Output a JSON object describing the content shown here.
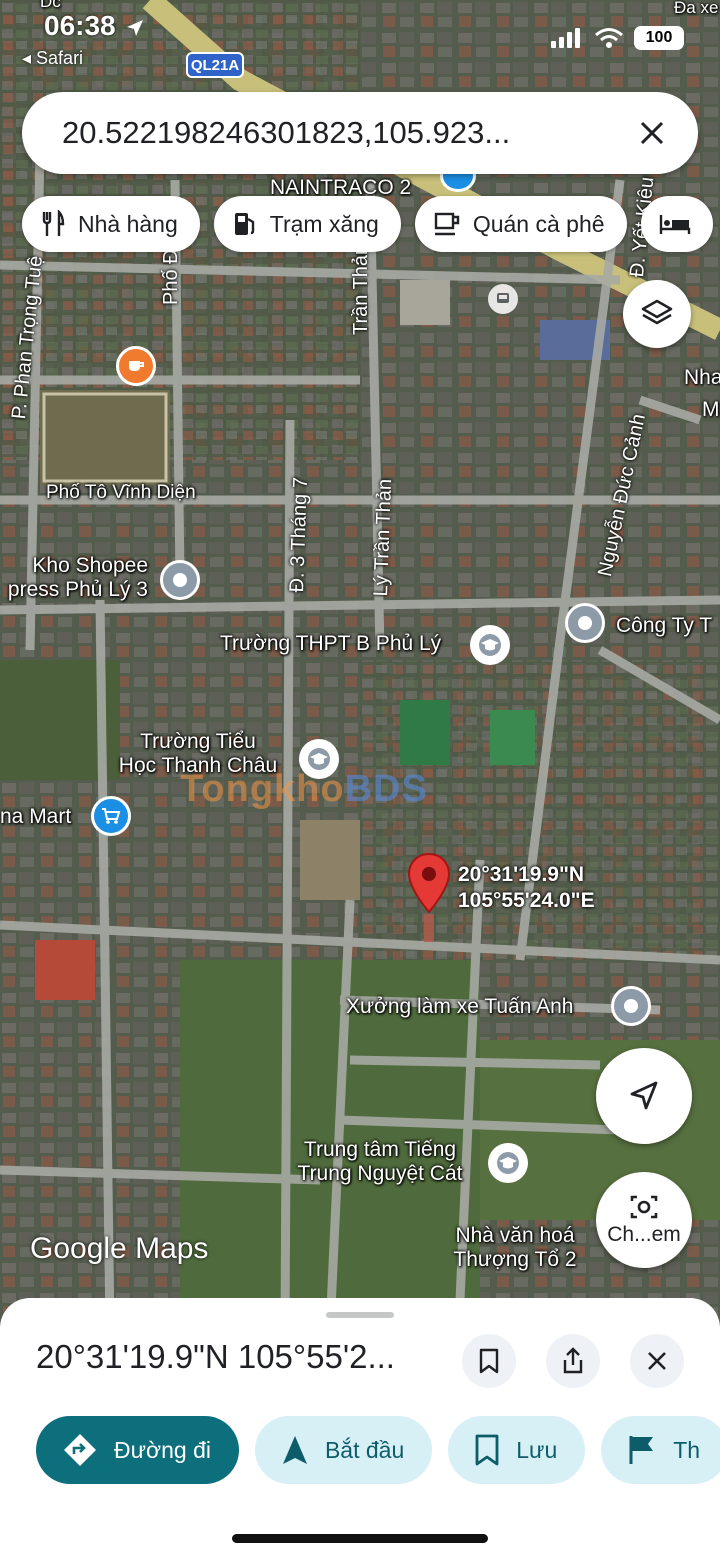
{
  "status": {
    "time": "06:38",
    "back_app": "◂ Safari",
    "battery": "100",
    "route_shield": "QL21A"
  },
  "search": {
    "query": "20.522198246301823,105.923...",
    "clear_icon": "close-icon"
  },
  "chips": [
    {
      "icon": "restaurant-icon",
      "label": "Nhà hàng"
    },
    {
      "icon": "gas-station-icon",
      "label": "Trạm xăng"
    },
    {
      "icon": "coffee-icon",
      "label": "Quán cà phê"
    },
    {
      "icon": "hotel-icon",
      "label": ""
    }
  ],
  "map": {
    "labels": {
      "naintraco": "NAINTRACO 2",
      "pho_to_vinh_dien": "Phố Tô Vĩnh Diện",
      "kho_shopee_1": "Kho Shopee",
      "kho_shopee_2": "press Phủ Lý 3",
      "cong_ty": "Công Ty T",
      "truong_thpt": "Trường THPT B Phủ Lý",
      "truong_tieu_hoc_1": "Trường Tiểu",
      "truong_tieu_hoc_2": "Học Thanh Châu",
      "mart": "na Mart",
      "xuong": "Xưởng làm xe Tuấn Anh",
      "trung_tam_1": "Trung tâm Tiếng",
      "trung_tam_2": "Trung Nguyệt Cát",
      "nha_van_hoa_1": "Nhà văn hoá",
      "nha_van_hoa_2": "Thượng Tổ 2",
      "nha_edge": "Nha",
      "m_edge": "M",
      "da_xe": "Đa xe",
      "top_dc": "Dc"
    },
    "street_labels": {
      "phan_trong_tue": "P. Phan Trọng Tuệ",
      "pho_dinh": "Phố Đinh",
      "tran_than_top": "Trần Thản",
      "ly_tran_than": "Lý Trần Thản",
      "d3_thang_7": "Đ. 3 Tháng 7",
      "nguyen_duc_canh": "Nguyễn Đức Cảnh",
      "d_yet_kieu": "Đ. Yết Kiêu"
    },
    "pin_coords_line1": "20°31'19.9\"N",
    "pin_coords_line2": "105°55'24.0\"E",
    "watermark_a": "Tongkho",
    "watermark_b": "BDS",
    "logo": "Google Maps",
    "layers_icon": "layers-icon",
    "locate_icon": "navigation-arrow-icon",
    "search_area_label": "Ch...em"
  },
  "sheet": {
    "title": "20°31'19.9\"N 105°55'2...",
    "save_icon": "bookmark-icon",
    "share_icon": "share-icon",
    "close_icon": "close-icon",
    "actions": [
      {
        "icon": "directions-icon",
        "label": "Đường đi"
      },
      {
        "icon": "start-arrow-icon",
        "label": "Bắt đầu"
      },
      {
        "icon": "bookmark-icon",
        "label": "Lưu"
      },
      {
        "icon": "flag-icon",
        "label": "Th"
      }
    ]
  },
  "colors": {
    "primary": "#0d6e7c",
    "action_bg": "#d7f0f6",
    "pin": "#e53935"
  }
}
